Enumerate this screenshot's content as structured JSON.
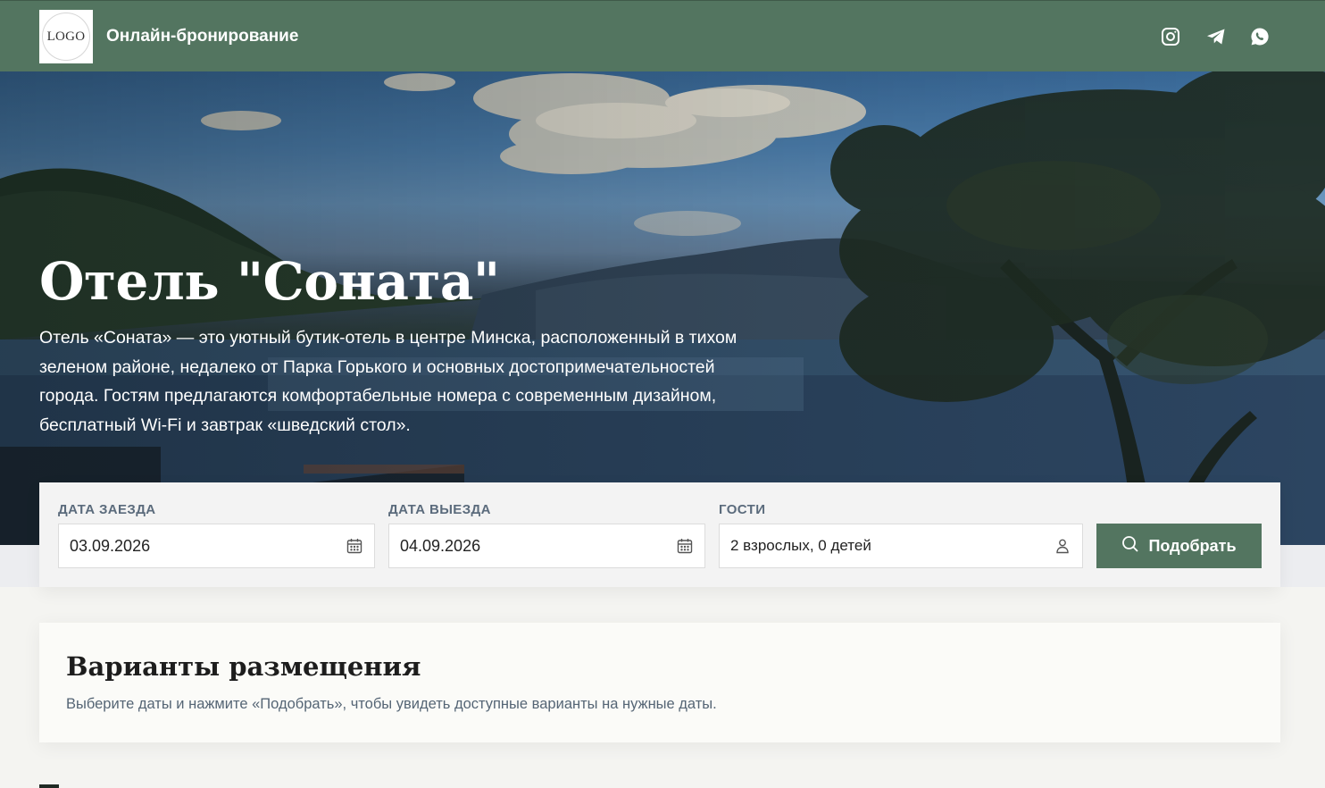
{
  "header": {
    "logo_text": "LOGO",
    "site_title": "Онлайн-бронирование",
    "social": [
      {
        "icon": "instagram-icon"
      },
      {
        "icon": "telegram-icon"
      },
      {
        "icon": "whatsapp-icon"
      }
    ]
  },
  "hero": {
    "title": "Отель \"Соната\"",
    "description": "Отель «Соната» — это уютный бутик-отель в центре Минска, расположенный в тихом зеленом районе, недалеко от Парка Горького и основных достопримечательностей города. Гостям предлагаются комфортабельные номера с современным дизайном, бесплатный Wi-Fi и завтрак «шведский стол»."
  },
  "booking": {
    "checkin_label": "ДАТА ЗАЕЗДА",
    "checkin_value": "03.09.2026",
    "checkout_label": "ДАТА ВЫЕЗДА",
    "checkout_value": "04.09.2026",
    "guests_label": "ГОСТИ",
    "guests_value": "2 взрослых, 0 детей",
    "search_label": "Подобрать"
  },
  "accommodation": {
    "title": "Варианты размещения",
    "hint": "Выберите даты и нажмите «Подобрать», чтобы увидеть доступные варианты на нужные даты."
  },
  "colors": {
    "brand": "#537560",
    "label": "#5b6b7c"
  }
}
